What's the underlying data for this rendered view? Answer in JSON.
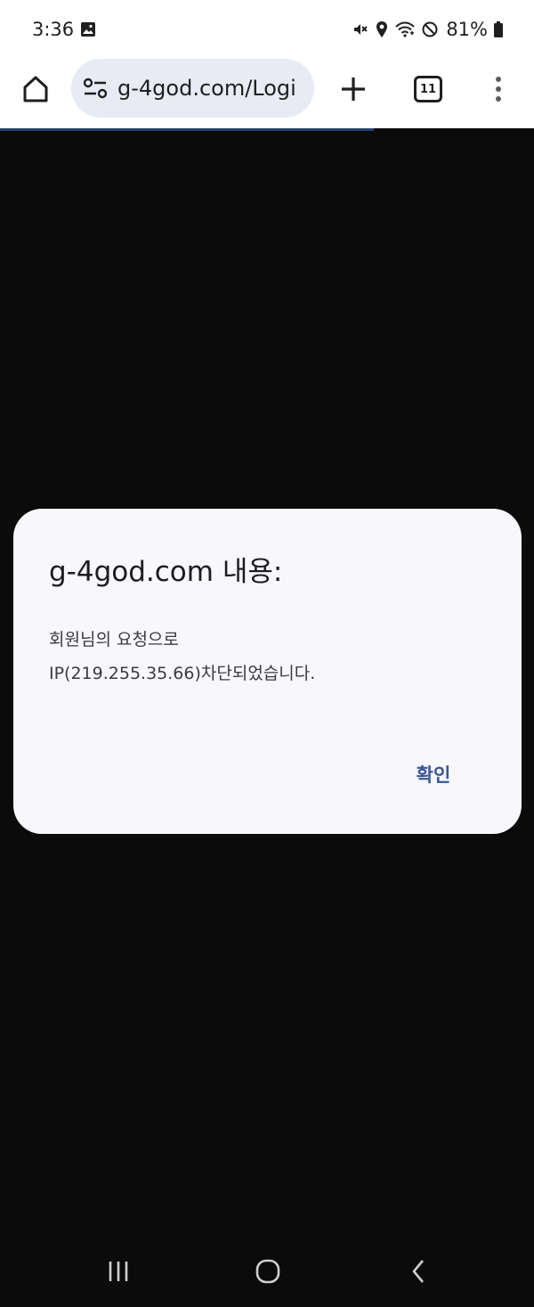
{
  "status_bar": {
    "time": "3:36",
    "battery": "81%",
    "icons": [
      "gallery-icon",
      "mute-icon",
      "location-icon",
      "wifi-icon",
      "do-not-disturb-icon",
      "battery-icon"
    ]
  },
  "browser": {
    "url": "g-4god.com/Logi",
    "tab_count": "11",
    "icons": [
      "home-icon",
      "site-info-icon",
      "plus-icon",
      "tabs-icon",
      "more-vert-icon"
    ]
  },
  "dialog": {
    "title": "g-4god.com 내용:",
    "message_line1": "회원님의 요청으로",
    "message_line2": "IP(219.255.35.66)차단되었습니다.",
    "ok_label": "확인"
  },
  "nav_bar": {
    "icons": [
      "recents-icon",
      "home-circle-icon",
      "back-icon"
    ]
  },
  "colors": {
    "background": "#0b0b0c",
    "dialog_bg": "#f7f7fc",
    "accent": "#3b5692",
    "url_bar_bg": "#e8ebf3"
  }
}
